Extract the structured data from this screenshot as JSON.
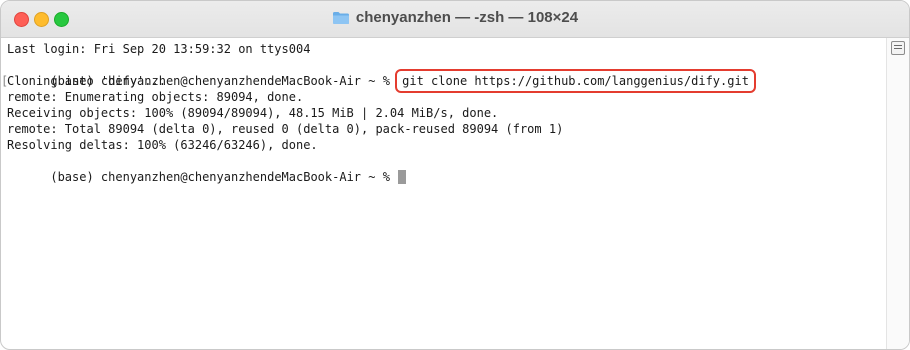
{
  "window": {
    "title": "chenyanzhen — -zsh — 108×24",
    "folder_icon": "folder-icon",
    "buttons": [
      "close",
      "minimize",
      "zoom"
    ]
  },
  "terminal": {
    "login_line": "Last login: Fri Sep 20 13:59:32 on ttys004",
    "prompt": "(base) chenyanzhen@chenyanzhendeMacBook-Air ~ % ",
    "command": "git clone https://github.com/langgenius/dify.git",
    "output_lines": [
      "Cloning into 'dify'...",
      "remote: Enumerating objects: 89094, done.",
      "Receiving objects: 100% (89094/89094), 48.15 MiB | 2.04 MiB/s, done.",
      "remote: Total 89094 (delta 0), reused 0 (delta 0), pack-reused 89094 (from 1)",
      "Resolving deltas: 100% (63246/63246), done."
    ],
    "final_prompt": "(base) chenyanzhen@chenyanzhendeMacBook-Air ~ % ",
    "bracket_left": "[",
    "bracket_right": "]"
  },
  "colors": {
    "highlight_box": "#e43c2f",
    "cursor": "#9a9a9a",
    "text": "#1a1a1a"
  }
}
